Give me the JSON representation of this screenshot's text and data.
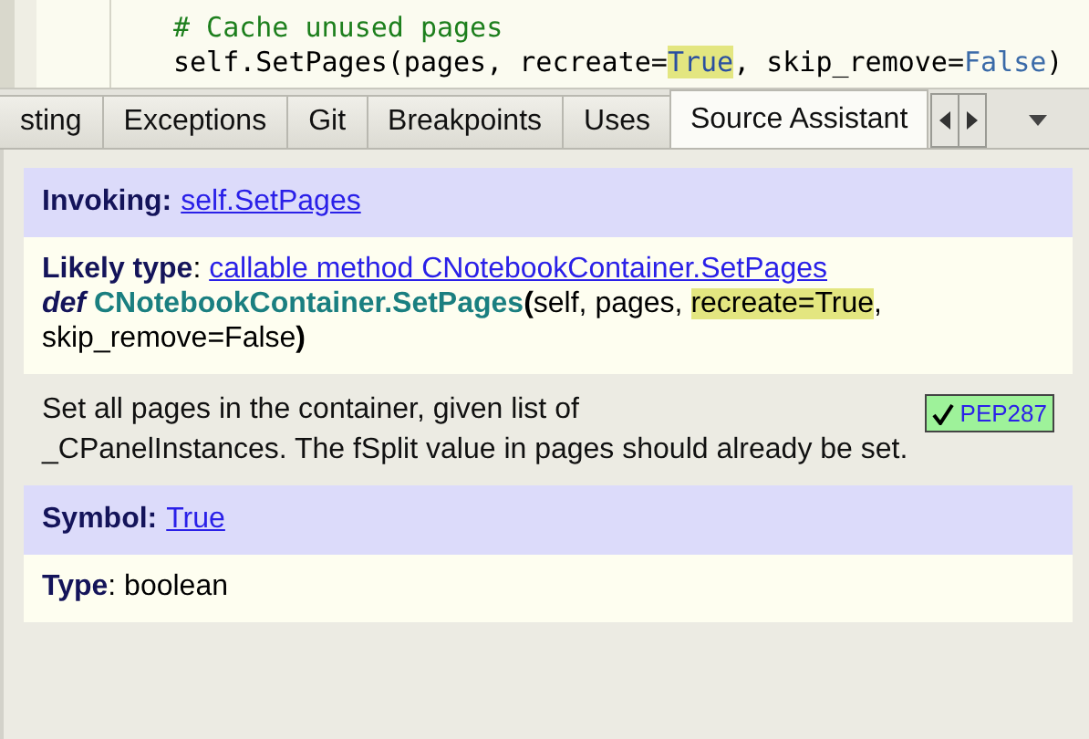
{
  "editor": {
    "lines": [
      {
        "segments": [
          {
            "kind": "comment",
            "text": "# Cache unused pages"
          }
        ]
      },
      {
        "segments": [
          {
            "kind": "plain",
            "text": "self.SetPages(pages, recreate="
          },
          {
            "kind": "highlight",
            "text": "True"
          },
          {
            "kind": "plain",
            "text": ", skip_remove="
          },
          {
            "kind": "constant",
            "text": "False"
          },
          {
            "kind": "plain",
            "text": ")"
          }
        ]
      }
    ]
  },
  "tabs": [
    {
      "label": "sting",
      "selected": false
    },
    {
      "label": "Exceptions",
      "selected": false
    },
    {
      "label": "Git",
      "selected": false
    },
    {
      "label": "Breakpoints",
      "selected": false
    },
    {
      "label": "Uses",
      "selected": false
    },
    {
      "label": "Source Assistant",
      "selected": true
    }
  ],
  "invoking": {
    "label": "Invoking:",
    "link": "self.SetPages"
  },
  "likely_type": {
    "label": "Likely type",
    "separator": ":",
    "link": "callable method CNotebookContainer.SetPages",
    "signature": [
      {
        "kind": "keyword",
        "text": "def"
      },
      {
        "kind": "name",
        "text": "CNotebookContainer.SetPages"
      },
      {
        "kind": "paren",
        "text": "("
      },
      {
        "kind": "plain",
        "text": "self, pages, "
      },
      {
        "kind": "highlight",
        "text": "recreate=True"
      },
      {
        "kind": "plain",
        "text": ", skip_remove=False"
      },
      {
        "kind": "paren",
        "text": ")"
      }
    ]
  },
  "description": {
    "lines": [
      "Set all pages in the container, given list of",
      "_CPanelInstances. The fSplit value in pages should already be set."
    ],
    "badge": "PEP287"
  },
  "symbol": {
    "label": "Symbol:",
    "link": "True"
  },
  "type": {
    "label": "Type",
    "separator": ":",
    "value": "boolean"
  }
}
